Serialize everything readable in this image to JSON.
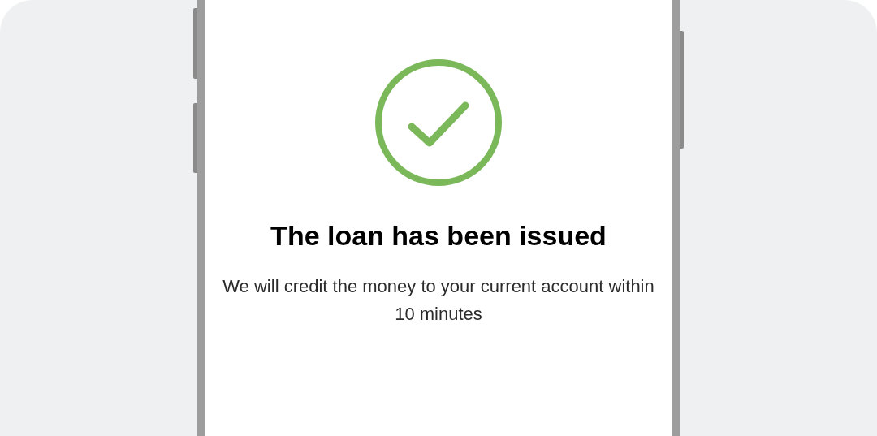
{
  "title": "The loan has been issued",
  "message": "We will credit the money to your current account within 10 minutes"
}
